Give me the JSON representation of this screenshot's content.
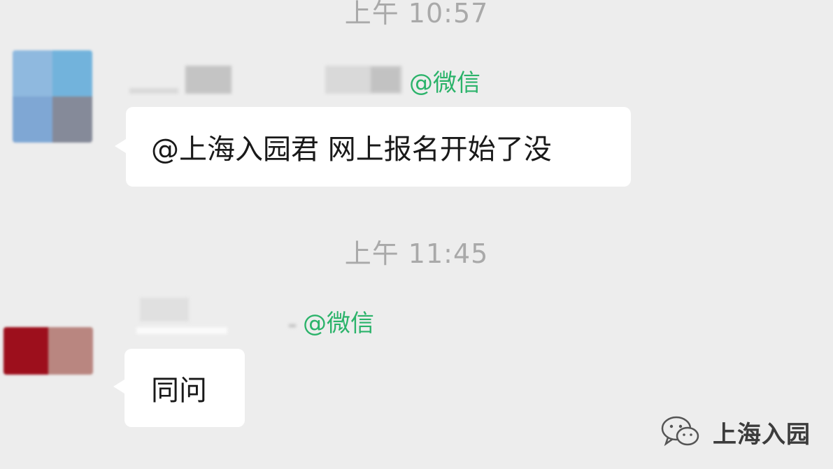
{
  "chat": {
    "messages_group_1": {
      "timestamp": "上午 10:57",
      "sender_suffix": "@微信",
      "text": "@上海入园君 网上报名开始了没"
    },
    "messages_group_2": {
      "timestamp": "上午 11:45",
      "sender_suffix": "@微信",
      "text": "同问"
    }
  },
  "watermark": {
    "brand_name": "上海入园"
  },
  "colors": {
    "background": "#ededed",
    "bubble": "#ffffff",
    "mention_green": "#2bb36a",
    "timestamp_gray": "#a9a9a9"
  },
  "icons": {
    "brand_icon": "wechat-icon"
  }
}
